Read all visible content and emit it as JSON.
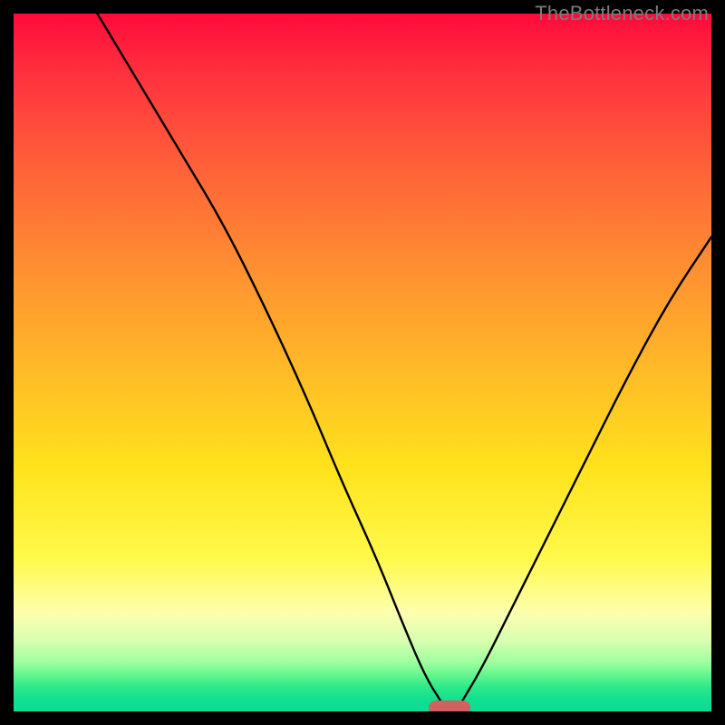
{
  "watermark": "TheBottleneck.com",
  "chart_data": {
    "type": "line",
    "title": "",
    "xlabel": "",
    "ylabel": "",
    "xlim": [
      0,
      100
    ],
    "ylim": [
      0,
      100
    ],
    "grid": false,
    "legend": false,
    "colors": {
      "gradient_top": "#ff0a3a",
      "gradient_bottom": "#07dd94",
      "curve": "#000000",
      "marker": "#d1605e",
      "frame": "#000000"
    },
    "series": [
      {
        "name": "left-branch",
        "x": [
          12,
          18,
          24,
          30,
          36,
          42,
          47,
          52,
          56,
          59,
          61.5
        ],
        "y": [
          100,
          90,
          80,
          70,
          58,
          45,
          33,
          22,
          12,
          5,
          1
        ]
      },
      {
        "name": "right-branch",
        "x": [
          64,
          67,
          71,
          76,
          82,
          88,
          94,
          100
        ],
        "y": [
          1,
          6,
          14,
          24,
          36,
          48,
          59,
          68
        ]
      }
    ],
    "marker": {
      "x": 62.5,
      "y": 0.5,
      "shape": "pill"
    }
  }
}
